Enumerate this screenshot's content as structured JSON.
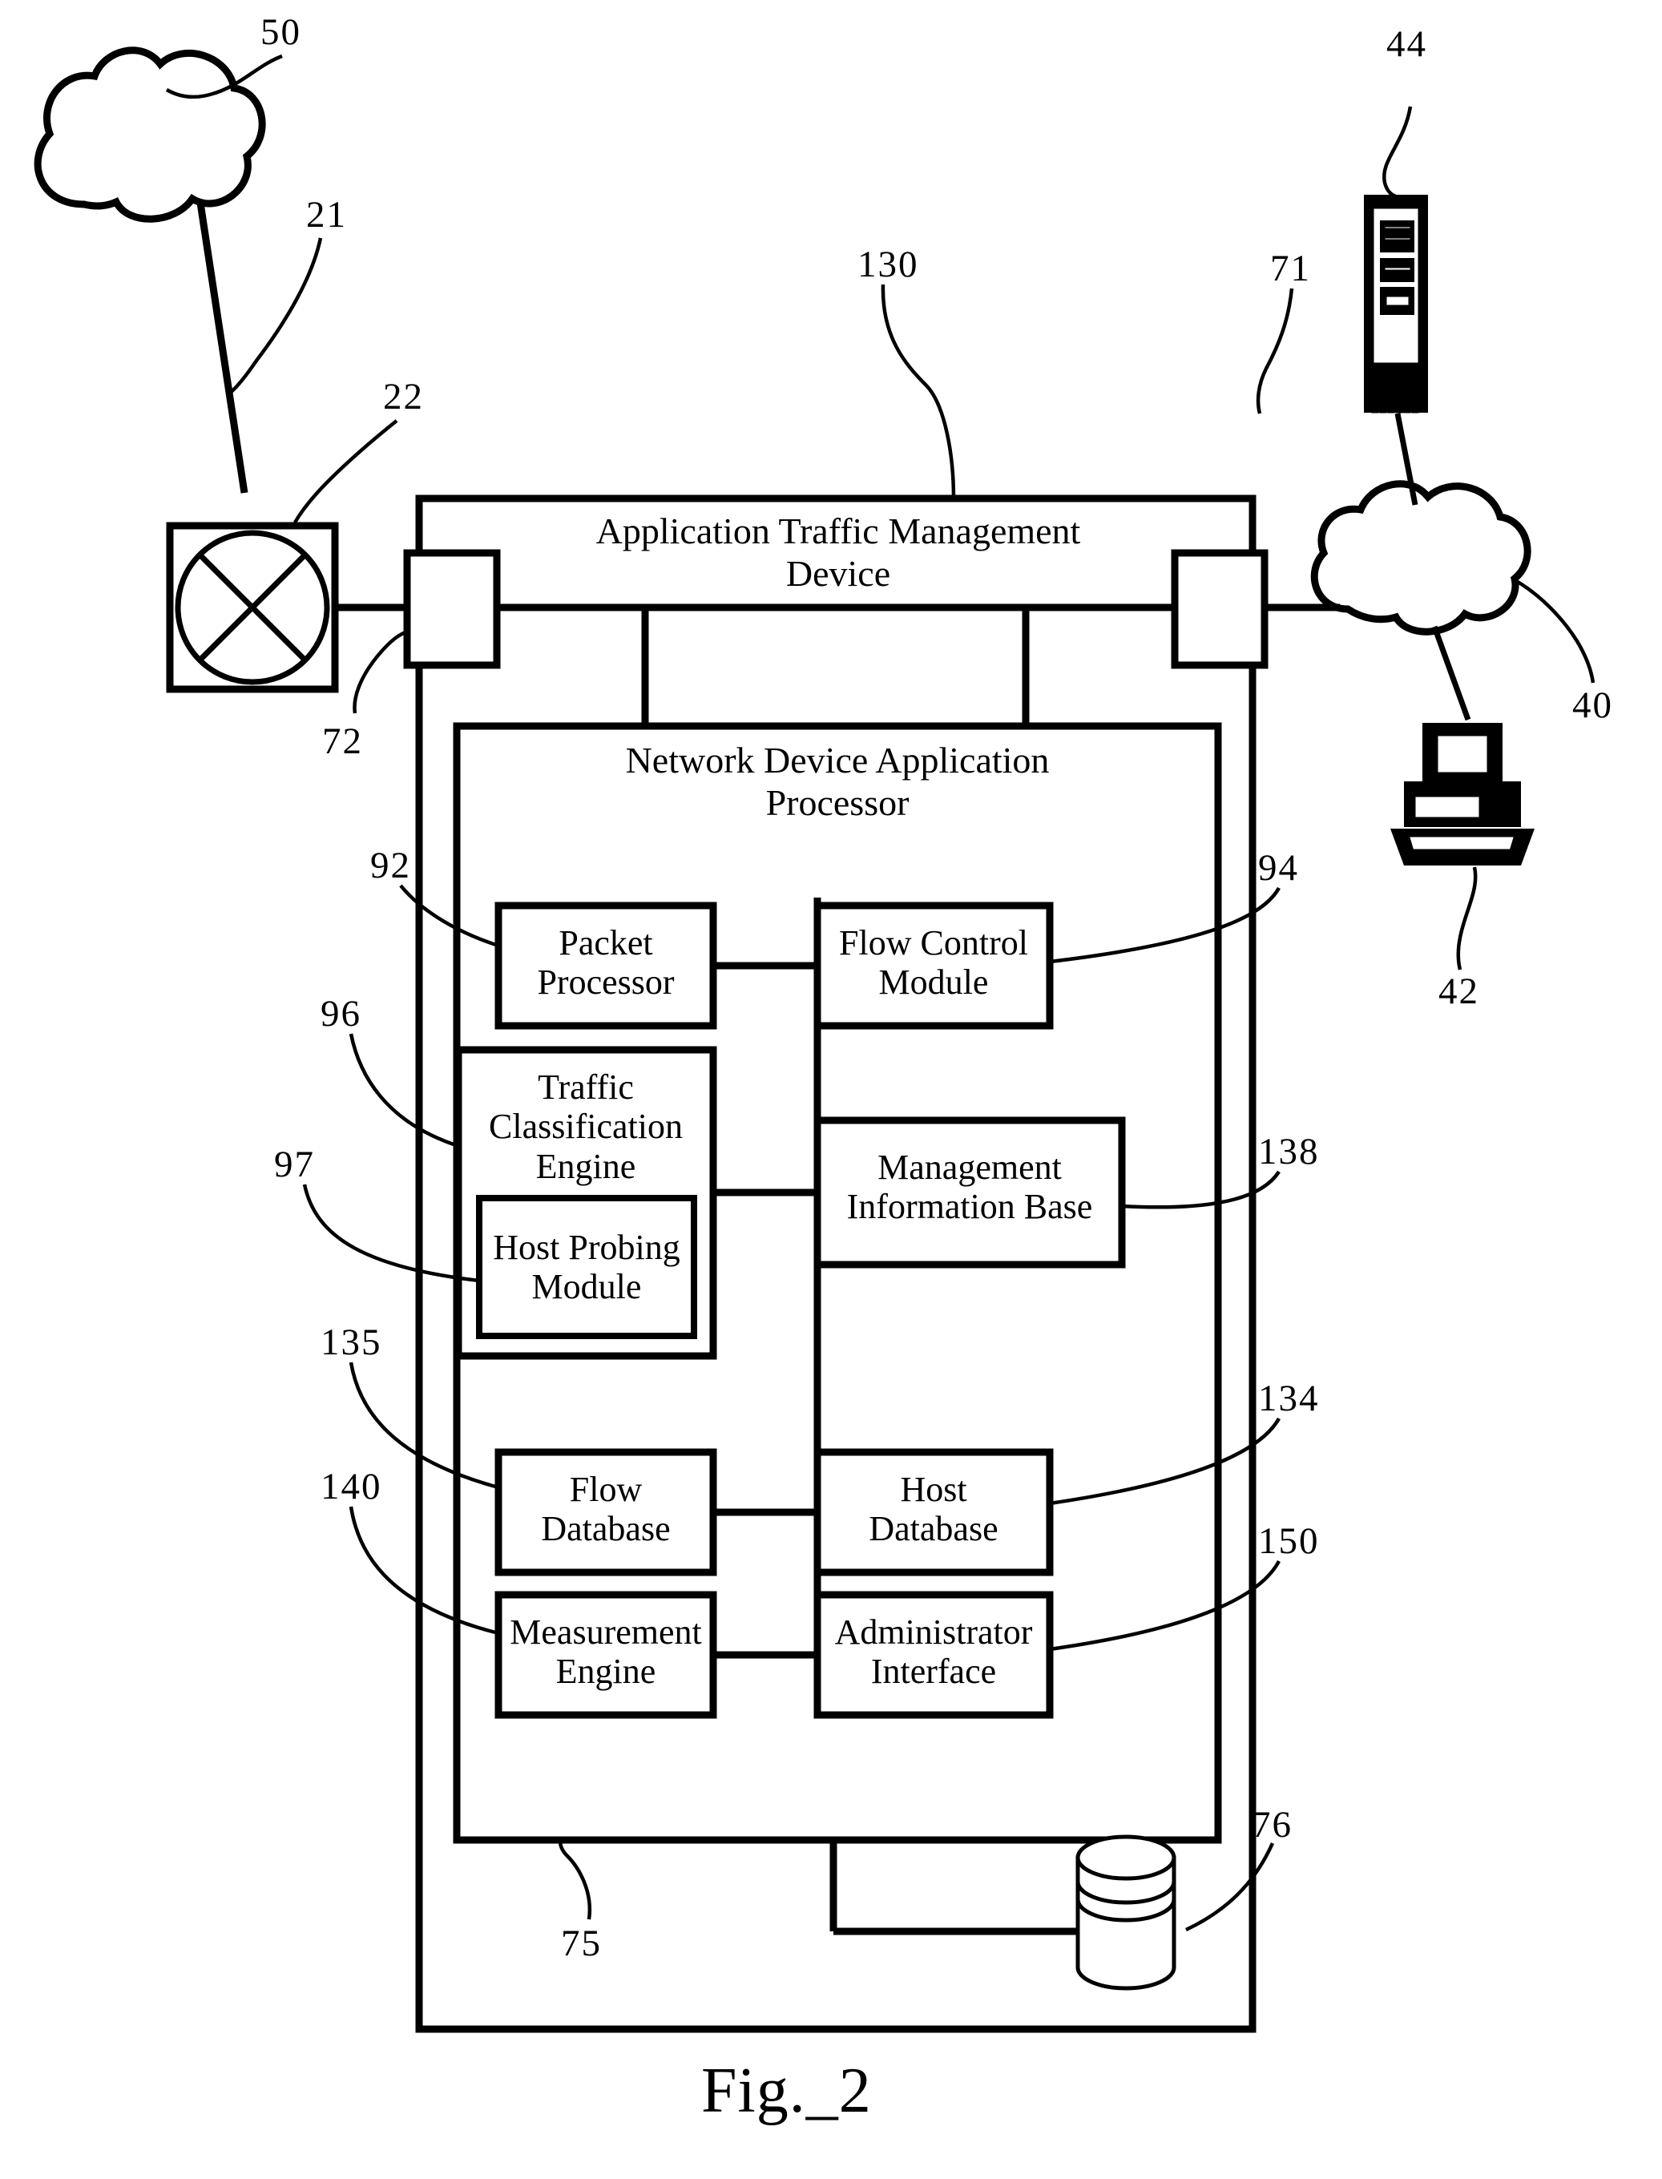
{
  "figure": {
    "caption": "Fig._2"
  },
  "device": {
    "title": "Application Traffic Management Device",
    "processor_title": "Network Device Application Processor"
  },
  "modules": [
    {
      "id": "packet-processor",
      "label": "Packet Processor",
      "ref": "92"
    },
    {
      "id": "flow-control-module",
      "label": "Flow Control Module",
      "ref": "94"
    },
    {
      "id": "traffic-classification-engine",
      "label": "Traffic Classification Engine",
      "ref": "96"
    },
    {
      "id": "host-probing-module",
      "label": "Host Probing Module",
      "ref": "97"
    },
    {
      "id": "management-information-base",
      "label": "Management Information Base",
      "ref": "138"
    },
    {
      "id": "flow-database",
      "label": "Flow Database",
      "ref": "135"
    },
    {
      "id": "host-database",
      "label": "Host Database",
      "ref": "134"
    },
    {
      "id": "measurement-engine",
      "label": "Measurement Engine",
      "ref": "140"
    },
    {
      "id": "administrator-interface",
      "label": "Administrator Interface",
      "ref": "150"
    }
  ],
  "module_text": {
    "packet_processor_line1": "Packet",
    "packet_processor_line2": "Processor",
    "flow_control_line1": "Flow Control",
    "flow_control_line2": "Module",
    "traffic_class_line1": "Traffic",
    "traffic_class_line2": "Classification",
    "traffic_class_line3": "Engine",
    "host_probing_line1": "Host Probing",
    "host_probing_line2": "Module",
    "mib_line1": "Management",
    "mib_line2": "Information Base",
    "flow_db_line1": "Flow",
    "flow_db_line2": "Database",
    "host_db_line1": "Host",
    "host_db_line2": "Database",
    "measurement_line1": "Measurement",
    "measurement_line2": "Engine",
    "admin_line1": "Administrator",
    "admin_line2": "Interface",
    "device_title_line1": "Application Traffic Management",
    "device_title_line2": "Device",
    "processor_title_line1": "Network Device Application",
    "processor_title_line2": "Processor"
  },
  "reference_numerals": {
    "cloud_left": "50",
    "link_21": "21",
    "router_22": "22",
    "device_130": "130",
    "server_44": "44",
    "iface_71": "71",
    "iface_72": "72",
    "cloud_right": "40",
    "computer_42": "42",
    "packet_processor": "92",
    "flow_control": "94",
    "traffic_classification": "96",
    "host_probing": "97",
    "mib": "138",
    "flow_database": "135",
    "host_database": "134",
    "measurement_engine": "140",
    "administrator_interface": "150",
    "bus_75": "75",
    "persistent_store_76": "76"
  },
  "icons": {
    "cloud_left": "cloud-icon",
    "cloud_right": "cloud-icon",
    "router": "router-icon",
    "server": "server-tower-icon",
    "computer": "desktop-computer-icon",
    "database": "database-cylinder-icon"
  }
}
